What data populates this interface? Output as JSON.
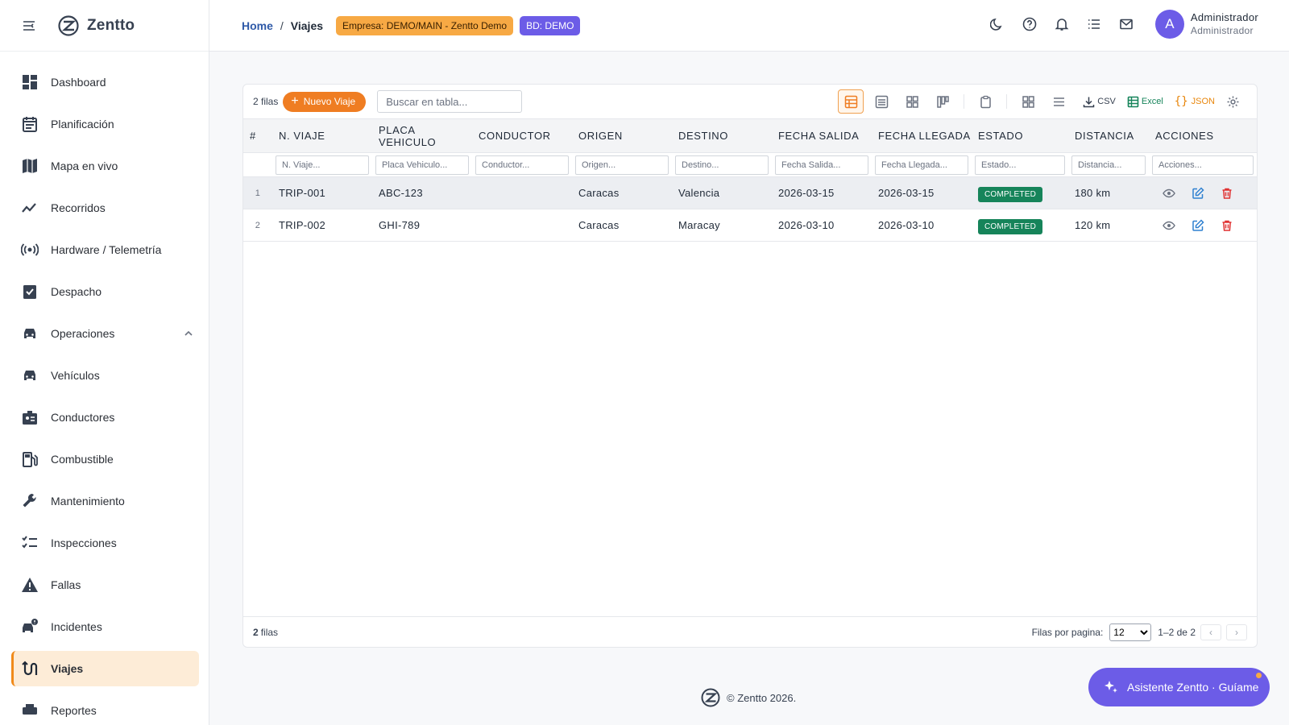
{
  "brand": {
    "name": "Zentto"
  },
  "sidebar": {
    "items": [
      {
        "label": "Dashboard",
        "icon": "dashboard-icon"
      },
      {
        "label": "Planificación",
        "icon": "calendar-icon"
      },
      {
        "label": "Mapa en vivo",
        "icon": "map-icon"
      },
      {
        "label": "Recorridos",
        "icon": "trend-icon"
      },
      {
        "label": "Hardware / Telemetría",
        "icon": "sensor-icon"
      },
      {
        "label": "Despacho",
        "icon": "clipboard-check-icon"
      },
      {
        "label": "Operaciones",
        "icon": "car-icon"
      },
      {
        "label": "Vehículos",
        "icon": "car-icon"
      },
      {
        "label": "Conductores",
        "icon": "badge-icon"
      },
      {
        "label": "Combustible",
        "icon": "fuel-icon"
      },
      {
        "label": "Mantenimiento",
        "icon": "wrench-icon"
      },
      {
        "label": "Inspecciones",
        "icon": "checklist-icon"
      },
      {
        "label": "Fallas",
        "icon": "warning-icon"
      },
      {
        "label": "Incidentes",
        "icon": "incident-icon"
      },
      {
        "label": "Viajes",
        "icon": "route-icon"
      },
      {
        "label": "Reportes",
        "icon": "print-icon"
      }
    ]
  },
  "header": {
    "home": "Home",
    "separator": "/",
    "current": "Viajes",
    "company_chip": "Empresa: DEMO/MAIN - Zentto Demo",
    "db_chip": "BD: DEMO",
    "user_initial": "A",
    "user_name": "Administrador",
    "user_role": "Administrador"
  },
  "toolbar": {
    "rows_count": "2 filas",
    "new_button": "Nuevo Viaje",
    "search_placeholder": "Buscar en tabla...",
    "csv": "CSV",
    "excel": "Excel",
    "json": "JSON"
  },
  "table": {
    "index_header": "#",
    "columns": [
      "N. VIAJE",
      "PLACA VEHICULO",
      "CONDUCTOR",
      "ORIGEN",
      "DESTINO",
      "FECHA SALIDA",
      "FECHA LLEGADA",
      "ESTADO",
      "DISTANCIA",
      "ACCIONES"
    ],
    "filters": [
      "N. Viaje...",
      "Placa Vehiculo...",
      "Conductor...",
      "Origen...",
      "Destino...",
      "Fecha Salida...",
      "Fecha Llegada...",
      "Estado...",
      "Distancia...",
      "Acciones..."
    ],
    "rows": [
      {
        "idx": "1",
        "viaje": "TRIP-001",
        "placa": "ABC-123",
        "conductor": "",
        "origen": "Caracas",
        "destino": "Valencia",
        "salida": "2026-03-15",
        "llegada": "2026-03-15",
        "estado": "COMPLETED",
        "distancia": "180 km"
      },
      {
        "idx": "2",
        "viaje": "TRIP-002",
        "placa": "GHI-789",
        "conductor": "",
        "origen": "Caracas",
        "destino": "Maracay",
        "salida": "2026-03-10",
        "llegada": "2026-03-10",
        "estado": "COMPLETED",
        "distancia": "120 km"
      }
    ]
  },
  "footer": {
    "count_num": "2",
    "count_label": "filas",
    "per_page_label": "Filas por pagina:",
    "per_page_value": "12",
    "range": "1–2 de 2",
    "prev": "‹",
    "next": "›"
  },
  "copyright": "© Zentto 2026.",
  "assistant": {
    "label": "Asistente Zentto · Guíame"
  },
  "colors": {
    "accent": "#ef7d22",
    "purple": "#6c5ce7",
    "status_green": "#16845a",
    "edit_blue": "#2f80d0",
    "delete_red": "#e03131"
  }
}
